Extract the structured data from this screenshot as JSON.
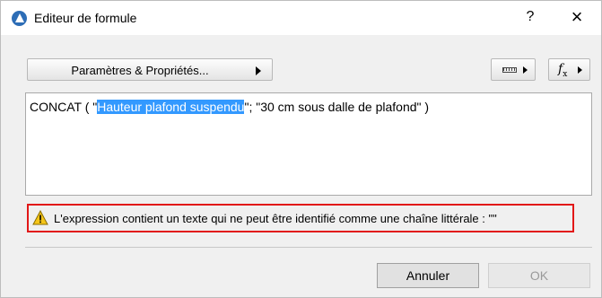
{
  "window": {
    "title": "Editeur de formule",
    "help_label": "?",
    "close_label": "×"
  },
  "toolbar": {
    "params_label": "Paramètres & Propriétés..."
  },
  "formula": {
    "before": "CONCAT ( \"",
    "selected": "Hauteur plafond suspendu",
    "after": "\"; \"30 cm sous dalle de plafond\" )"
  },
  "error": {
    "message": "L'expression contient un texte qui ne peut être identifié comme une chaîne littérale : \"\""
  },
  "buttons": {
    "cancel": "Annuler",
    "ok": "OK"
  },
  "colors": {
    "selection": "#3399ff",
    "error_border": "#e21818",
    "warning_fill": "#f5c518",
    "app_icon": "#2d6db6"
  },
  "icons": {
    "app": "archicad-logo-icon",
    "ruler": "ruler-icon",
    "function": "fx-icon",
    "warning": "warning-icon"
  }
}
